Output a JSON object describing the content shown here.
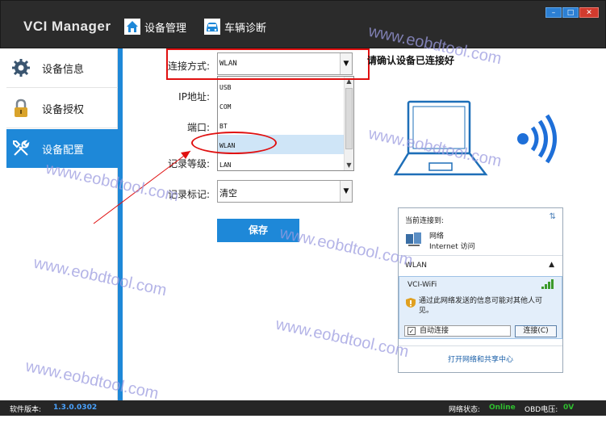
{
  "app": {
    "title": "VCI Manager",
    "nav": [
      {
        "label": "设备管理",
        "icon": "home-icon"
      },
      {
        "label": "车辆诊断",
        "icon": "car-icon"
      }
    ],
    "window_controls": [
      "minimize",
      "maximize",
      "close"
    ]
  },
  "sidebar": {
    "items": [
      {
        "label": "设备信息",
        "icon": "gear-icon",
        "active": false
      },
      {
        "label": "设备授权",
        "icon": "lock-icon",
        "active": false
      },
      {
        "label": "设备配置",
        "icon": "tools-icon",
        "active": true
      }
    ]
  },
  "form": {
    "connection_label": "连接方式:",
    "connection_value": "WLAN",
    "ip_label": "IP地址:",
    "port_label": "端口:",
    "log_level_label": "记录等级:",
    "log_mark_label": "记录标记:",
    "log_mark_value": "清空",
    "save_label": "保存",
    "dropdown_options": [
      "USB",
      "COM",
      "BT",
      "WLAN",
      "LAN"
    ],
    "dropdown_selected": "WLAN"
  },
  "right_panel": {
    "instruction": "请确认设备已连接好",
    "wifi_popup": {
      "header": "当前连接到:",
      "network_name": "网络",
      "network_sub": "Internet 访问",
      "wlan_label": "WLAN",
      "ssid": "VCI-WiFi",
      "warning": "通过此网络发送的信息可能对其他人可见。",
      "auto_connect": "自动连接",
      "connect_button": "连接(C)",
      "open_center_link": "打开网络和共享中心"
    }
  },
  "status": {
    "version_label": "软件版本:",
    "version": "1.3.0.0302",
    "network_label": "网络状态:",
    "network_value": "Online",
    "obd_label": "OBD电压:",
    "obd_value": "0V"
  },
  "watermark": "www.eobdtool.com",
  "colors": {
    "accent": "#1e88d8",
    "titlebar": "#2b2b2b",
    "annotation": "#e01010",
    "status_ok": "#2fbf2f"
  }
}
